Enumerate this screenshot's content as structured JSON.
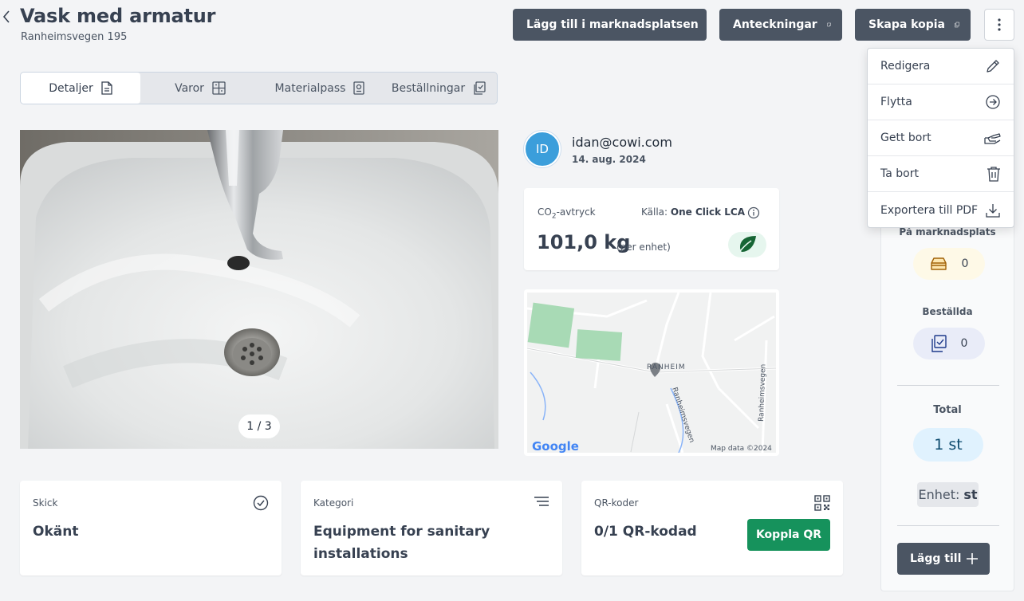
{
  "header": {
    "title": "Vask med armatur",
    "subtitle": "Ranheimsvegen 195",
    "buttons": {
      "marketplace": "Lägg till i marknadsplatsen",
      "notes": "Anteckningar",
      "copy": "Skapa kopia"
    }
  },
  "tabs": [
    {
      "label": "Detaljer",
      "icon": "document-icon",
      "active": true
    },
    {
      "label": "Varor",
      "icon": "items-grid-icon",
      "active": false
    },
    {
      "label": "Materialpass",
      "icon": "passport-icon",
      "active": false
    },
    {
      "label": "Beställningar",
      "icon": "orders-clipboard-icon",
      "active": false
    }
  ],
  "gallery": {
    "counter": "1 / 3"
  },
  "user": {
    "initials": "ID",
    "email": "idan@cowi.com",
    "date": "14. aug. 2024"
  },
  "co2": {
    "label_prefix": "CO",
    "label_sub": "2",
    "label_suffix": "-avtryck",
    "source_label": "Källa:",
    "source_value": "One Click LCA",
    "value": "101,0 kg",
    "per_unit": "(per enhet)"
  },
  "map": {
    "place_label": "RANHEIM",
    "road_label_1": "Ranheimsvegen",
    "road_label_2": "Ranheimsvegen",
    "attribution": "Map data ©2024",
    "logo": "Google"
  },
  "cards": {
    "condition": {
      "label": "Skick",
      "value": "Okänt"
    },
    "category": {
      "label": "Kategori",
      "value_line1": "Equipment for sanitary",
      "value_line2": "installations"
    },
    "qr": {
      "label": "QR-koder",
      "value": "0/1 QR-kodad",
      "button": "Koppla QR"
    }
  },
  "side_panel": {
    "marketplace_label": "På marknadsplats",
    "marketplace_count": "0",
    "ordered_label": "Beställda",
    "ordered_count": "0",
    "total_label": "Total",
    "total_value": "1 st",
    "unit_label": "Enhet:",
    "unit_value": "st",
    "add_button": "Lägg till"
  },
  "menu": {
    "items": [
      {
        "label": "Redigera",
        "icon": "pencil-icon"
      },
      {
        "label": "Flytta",
        "icon": "arrow-circle-icon"
      },
      {
        "label": "Gett bort",
        "icon": "give-hand-icon"
      },
      {
        "label": "Ta bort",
        "icon": "trash-icon"
      },
      {
        "label": "Exportera till PDF",
        "icon": "download-icon"
      }
    ]
  },
  "colors": {
    "primary_button": "#4b5563",
    "avatar": "#3b9edb",
    "qr_button": "#16925c",
    "total_pill": "#e0f2fe"
  }
}
